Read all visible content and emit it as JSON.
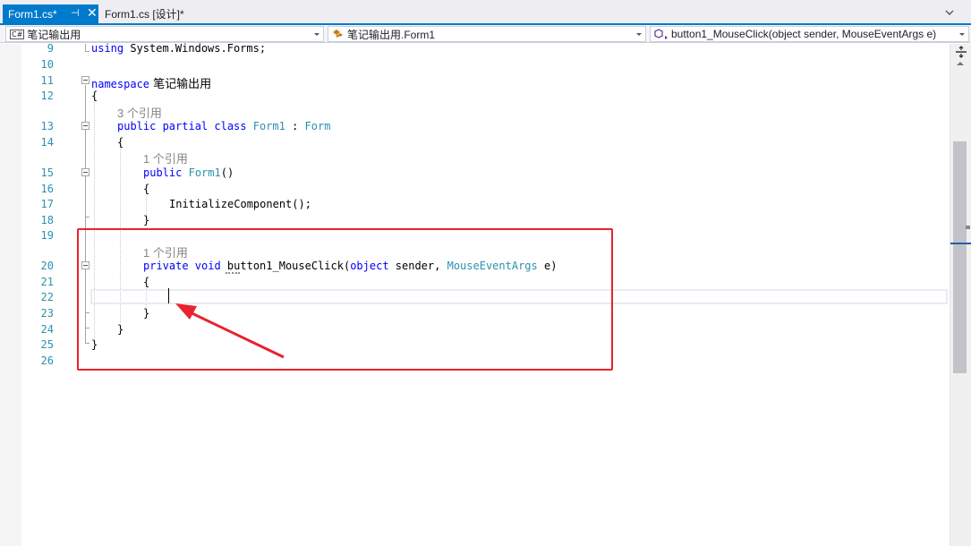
{
  "tabs": [
    {
      "label": "Form1.cs*",
      "pin_glyph": "⊣",
      "close_glyph": "✕",
      "active": true
    },
    {
      "label": "Form1.cs [设计]*",
      "active": false
    }
  ],
  "navbar": {
    "project": "笔记输出用",
    "project_badge": "C#",
    "type": "笔记输出用.Form1",
    "member": "button1_MouseClick(object sender, MouseEventArgs e)"
  },
  "line_numbers": [
    "9",
    "10",
    "11",
    "12",
    "13",
    "14",
    "15",
    "16",
    "17",
    "18",
    "19",
    "20",
    "21",
    "22",
    "23",
    "24",
    "25",
    "26"
  ],
  "code": {
    "line9_kw": "using",
    "line9_rest": " System.Windows.Forms;",
    "line11_kw": "namespace",
    "line11_name": " 笔记输出用",
    "line12": "{",
    "ref_class": "3 个引用",
    "line13_kw": "public partial class",
    "line13_name": "Form1",
    "line13_sep": " : ",
    "line13_base": "Form",
    "line14": "{",
    "ref_ctor": "1 个引用",
    "line15_kw": "public",
    "line15_name": "Form1",
    "line15_rest": "()",
    "line16": "{",
    "line17": "InitializeComponent();",
    "line18": "}",
    "ref_handler": "1 个引用",
    "line20_kw": "private void",
    "line20_name": " button1_MouseClick(",
    "line20_obj": "object",
    "line20_mid": " sender, ",
    "line20_type": "MouseEventArgs",
    "line20_end": " e)",
    "line21": "{",
    "line23": "}",
    "line24": "}",
    "line25": "}"
  },
  "colors": {
    "keyword": "#0000ff",
    "type": "#2b91af",
    "annotation": "#e8232e",
    "tab_active": "#007acc"
  }
}
